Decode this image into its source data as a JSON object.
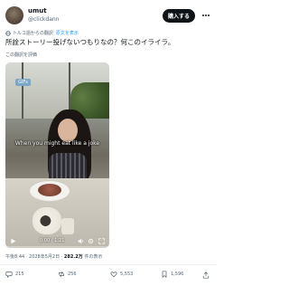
{
  "author": {
    "name": "umut",
    "handle": "@clickdann",
    "subscribe_label": "購入する"
  },
  "translation": {
    "from_label": "トルコ語からの翻訳",
    "show_original_label": "原文を表示"
  },
  "post": {
    "text": "所詮ストーリー投げないつもりなの？何このイライラ。",
    "rate_translation_label": "この翻訳を評価"
  },
  "video": {
    "badge": "GIFs",
    "caption": "When you might eat like a joke",
    "timecode": "0:00 / 1:21",
    "progress_fraction": 0.02
  },
  "meta": {
    "time": "午後8:44",
    "date": "2028年5月2日",
    "views_count": "282.2万",
    "views_label": "件の表示"
  },
  "actions": {
    "replies": "215",
    "reposts": "256",
    "likes": "5,553",
    "bookmarks": "1,596"
  },
  "colors": {
    "accent": "#1d9bf0",
    "text": "#0f1419",
    "muted": "#536471"
  }
}
